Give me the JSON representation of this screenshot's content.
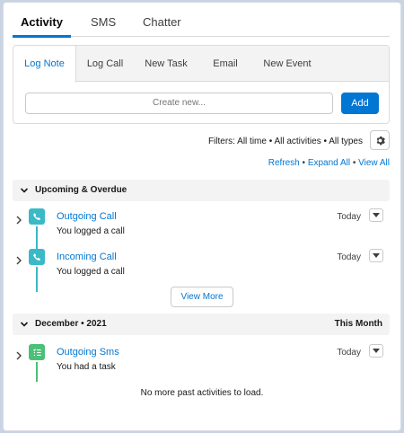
{
  "top_tabs": [
    "Activity",
    "SMS",
    "Chatter"
  ],
  "composer": {
    "tabs": [
      "Log Note",
      "Log Call",
      "New Task",
      "Email",
      "New Event"
    ],
    "input_placeholder": "Create new...",
    "add_label": "Add"
  },
  "filters": {
    "text": "Filters: All time • All activities • All types",
    "links": [
      "Refresh",
      "Expand All",
      "View All"
    ],
    "separator": "•"
  },
  "sections": [
    {
      "title": "Upcoming & Overdue",
      "right": "",
      "items": [
        {
          "subject": "Outgoing Call",
          "description": "You logged a call",
          "date": "Today",
          "icon": "call-icon",
          "color": "#3bb9c7"
        },
        {
          "subject": "Incoming Call",
          "description": "You logged a call",
          "date": "Today",
          "icon": "call-icon",
          "color": "#3bb9c7"
        }
      ],
      "view_more": "View More"
    },
    {
      "title": "December • 2021",
      "right": "This Month",
      "items": [
        {
          "subject": "Outgoing Sms",
          "description": "You had a task",
          "date": "Today",
          "icon": "task-icon",
          "color": "#4bc076"
        }
      ]
    }
  ],
  "no_more": "No more past activities to load.",
  "colors": {
    "brand": "#0176d3",
    "call": "#3bb9c7",
    "task": "#4bc076"
  }
}
